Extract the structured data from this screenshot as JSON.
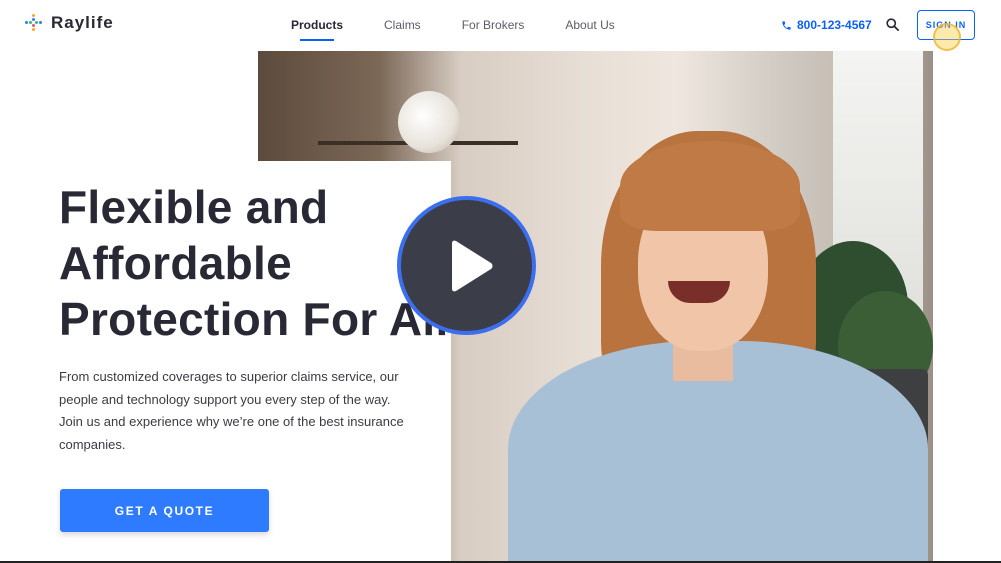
{
  "brand": {
    "name": "Raylife",
    "accent": "#0b5fff",
    "cta_color": "#2e7bff"
  },
  "nav": {
    "items": [
      {
        "label": "Products",
        "active": true
      },
      {
        "label": "Claims",
        "active": false
      },
      {
        "label": "For Brokers",
        "active": false
      },
      {
        "label": "About Us",
        "active": false
      }
    ]
  },
  "header": {
    "phone": "800-123-4567",
    "phone_icon": "phone-icon",
    "search_icon": "search-icon",
    "sign_in_label": "SIGN IN"
  },
  "hero": {
    "headline": [
      "Flexible and",
      "Affordable",
      "Protection For All"
    ],
    "subtext": "From customized coverages to superior claims service, our people and technology support you every step of the way. Join us and experience why we’re one of the best insurance companies.",
    "cta_label": "GET A QUOTE",
    "play_icon": "play-icon"
  }
}
